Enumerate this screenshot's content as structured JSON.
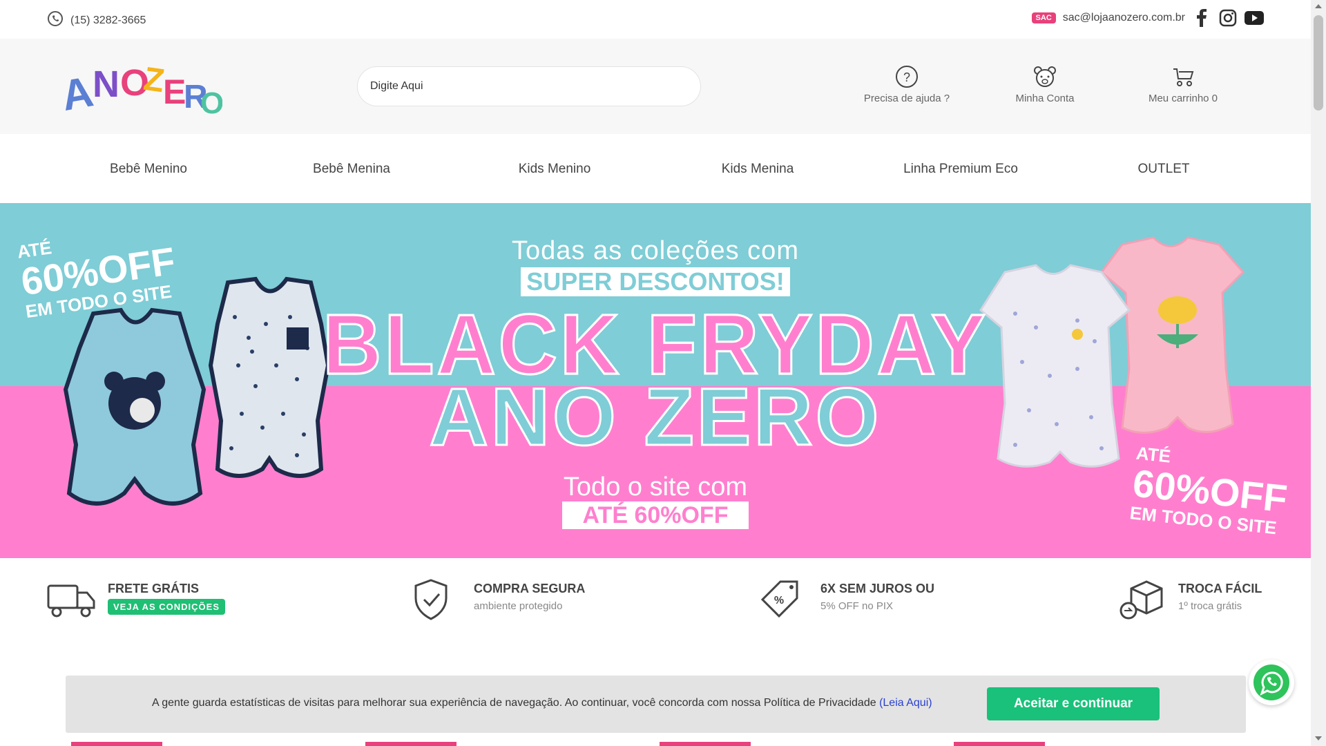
{
  "topbar": {
    "phone": "(15) 3282-3665",
    "sac_label": "SAC",
    "sac_email": "sac@lojaanozero.com.br"
  },
  "header": {
    "logo_text": "ANOZERO",
    "search_placeholder": "Digite Aqui",
    "help_label": "Precisa de ajuda ?",
    "account_label": "Minha Conta",
    "cart_label": "Meu carrinho 0"
  },
  "nav": {
    "items": [
      "Bebê Menino",
      "Bebê Menina",
      "Kids Menino",
      "Kids Menina",
      "Linha Premium Eco",
      "OUTLET"
    ]
  },
  "banner": {
    "headline_1": "Todas as coleções com",
    "headline_2": "SUPER DESCONTOS!",
    "big_1": "BLACK FRYDAY",
    "big_2": "ANO ZERO",
    "sub_1": "Todo o site com",
    "sub_2": "ATÉ 60%OFF",
    "promo_left": {
      "line1": "ATÉ",
      "line2": "60%OFF",
      "line3": "EM TODO O SITE"
    },
    "promo_right": {
      "line1": "ATÉ",
      "line2": "60%OFF",
      "line3": "EM TODO O SITE"
    },
    "colors": {
      "teal": "#7fcdd6",
      "pink": "#ff7fce"
    }
  },
  "features": [
    {
      "title": "FRETE GRÁTIS",
      "cta": "VEJA AS CONDIÇÕES"
    },
    {
      "title": "COMPRA SEGURA",
      "subtitle": "ambiente protegido"
    },
    {
      "title": "6X SEM JUROS OU",
      "subtitle": "5% OFF no PIX"
    },
    {
      "title": "TROCA FÁCIL",
      "subtitle": "1º troca grátis"
    }
  ],
  "cookie": {
    "text": "A gente guarda estatísticas de visitas para melhorar sua experiência de navegação. Ao continuar, você concorda com nossa Política de Privacidade ",
    "link": "(Leia Aqui)",
    "button": "Aceitar e continuar"
  },
  "icons": {
    "whatsapp": "whatsapp-icon",
    "facebook": "facebook-icon",
    "instagram": "instagram-icon",
    "youtube": "youtube-icon",
    "help": "question-circle-icon",
    "account": "bear-icon",
    "cart": "stroller-cart-icon"
  },
  "accent_colors": {
    "green": "#1fbf74",
    "sac_pink": "#e8417b"
  }
}
